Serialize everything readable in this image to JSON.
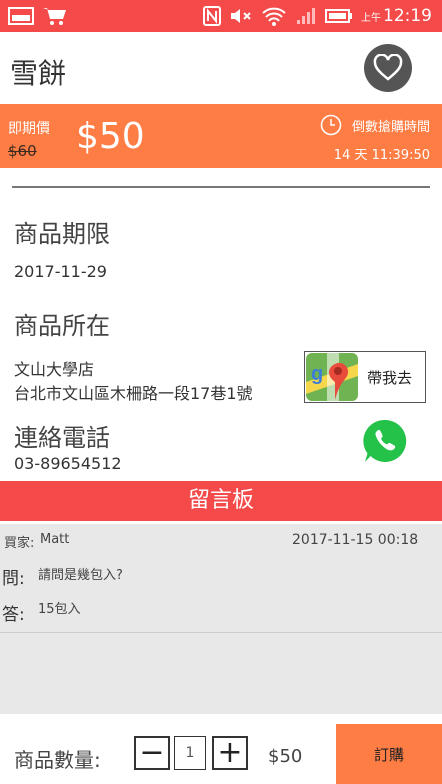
{
  "status": {
    "ampm": "上午",
    "time": "12:19"
  },
  "title": "雪餅",
  "price": {
    "label": "即期價",
    "original": "$60",
    "current": "$50",
    "countdown_label": "倒數搶購時間",
    "countdown_value": "14 天 11:39:50"
  },
  "expiry": {
    "heading": "商品期限",
    "date": "2017-11-29"
  },
  "location": {
    "heading": "商品所在",
    "store": "文山大學店",
    "address": "台北市文山區木柵路一段17巷1號",
    "map_button": "帶我去"
  },
  "contact": {
    "heading": "連絡電話",
    "phone": "03-89654512"
  },
  "board": {
    "heading": "留言板",
    "buyer_label": "買家:",
    "buyer": "Matt",
    "timestamp": "2017-11-15 00:18",
    "q_label": "問:",
    "question": "請問是幾包入?",
    "a_label": "答:",
    "answer": "15包入"
  },
  "footer": {
    "qty_label": "商品數量:",
    "minus": "−",
    "qty": "1",
    "plus": "+",
    "total": "$50",
    "order_button": "訂購"
  }
}
